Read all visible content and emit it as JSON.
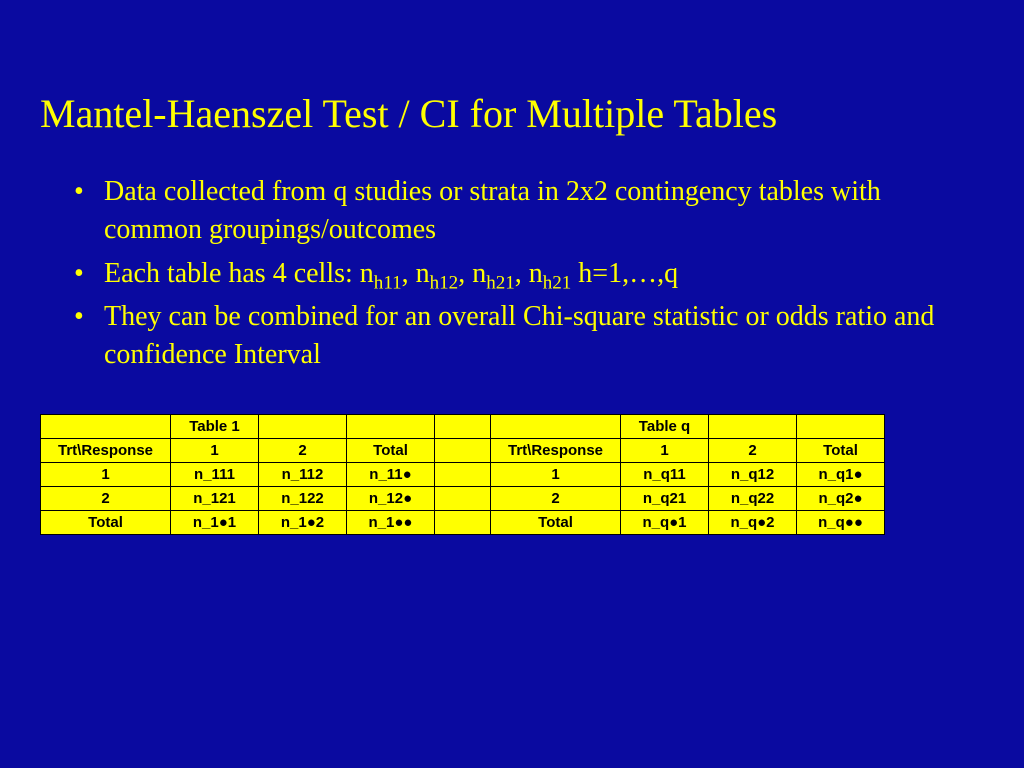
{
  "title": "Mantel-Haenszel Test / CI for Multiple Tables",
  "bullets": {
    "b1": "Data collected from q studies or strata in 2x2 contingency tables with common groupings/outcomes",
    "b2_pre": "Each table has 4 cells: n",
    "b2_s1": "h11",
    "b2_m1": ", n",
    "b2_s2": "h12",
    "b2_m2": ", n",
    "b2_s3": "h21",
    "b2_m3": ", n",
    "b2_s4": "h21",
    "b2_post": " h=1,…,q",
    "b3": "They can be combined for an overall Chi-square statistic or odds ratio and confidence Interval"
  },
  "table": {
    "left": {
      "header_offset": "",
      "header_title": "Table 1",
      "rows": [
        [
          "Trt\\Response",
          "1",
          "2",
          "Total"
        ],
        [
          "1",
          "n_111",
          "n_112",
          "n_11●"
        ],
        [
          "2",
          "n_121",
          "n_122",
          "n_12●"
        ],
        [
          "Total",
          "n_1●1",
          "n_1●2",
          "n_1●●"
        ]
      ]
    },
    "right": {
      "header_offset": "",
      "header_title": "Table q",
      "rows": [
        [
          "Trt\\Response",
          "1",
          "2",
          "Total"
        ],
        [
          "1",
          "n_q11",
          "n_q12",
          "n_q1●"
        ],
        [
          "2",
          "n_q21",
          "n_q22",
          "n_q2●"
        ],
        [
          "Total",
          "n_q●1",
          "n_q●2",
          "n_q●●"
        ]
      ]
    }
  }
}
